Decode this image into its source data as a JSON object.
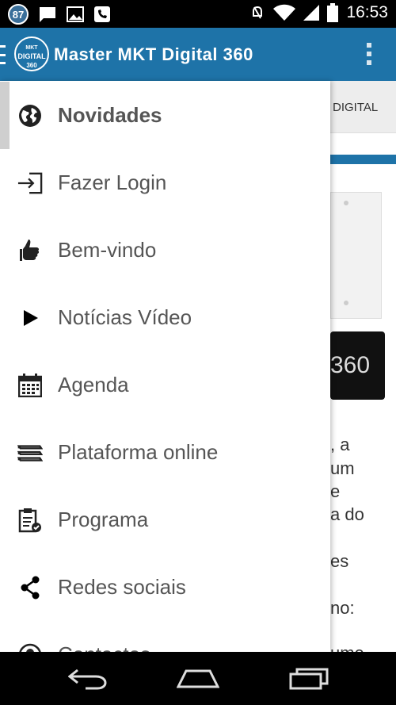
{
  "status_bar": {
    "notification_count": "87",
    "time": "16:53",
    "left_icons": [
      "chat-icon",
      "image-icon",
      "voicemail-icon"
    ],
    "right_icons": [
      "mute-icon",
      "wifi-icon",
      "signal-icon",
      "battery-icon"
    ]
  },
  "app_bar": {
    "logo": {
      "line1": "MKT",
      "line2": "DIGITAL",
      "line3": "360"
    },
    "title": "Master MKT Digital 360",
    "menu_icon": "hamburger-icon",
    "overflow_icon": "overflow-menu-icon"
  },
  "background_page": {
    "tab_label": "DIGITAL",
    "box_text": "360",
    "text_lines": [
      ", a",
      "um",
      "e",
      "a do",
      "es",
      "no:",
      "ume"
    ]
  },
  "drawer": {
    "items": [
      {
        "label": "Novidades",
        "icon": "globe-icon",
        "active": true
      },
      {
        "label": "Fazer Login",
        "icon": "login-icon",
        "active": false
      },
      {
        "label": "Bem-vindo",
        "icon": "thumbs-up-icon",
        "active": false
      },
      {
        "label": "Notícias Vídeo",
        "icon": "play-icon",
        "active": false
      },
      {
        "label": "Agenda",
        "icon": "calendar-icon",
        "active": false
      },
      {
        "label": "Plataforma online",
        "icon": "books-icon",
        "active": false
      },
      {
        "label": "Programa",
        "icon": "clipboard-check-icon",
        "active": false
      },
      {
        "label": "Redes sociais",
        "icon": "share-icon",
        "active": false
      },
      {
        "label": "Contactos",
        "icon": "contact-icon",
        "active": false
      }
    ]
  },
  "nav_bar": {
    "buttons": [
      "back-icon",
      "home-icon",
      "recents-icon"
    ]
  },
  "colors": {
    "app_bar": "#1e73a8",
    "status_bar": "#000000",
    "drawer_bg": "#ffffff",
    "drawer_text": "#555555",
    "selection_bar": "#cfcfcf"
  }
}
